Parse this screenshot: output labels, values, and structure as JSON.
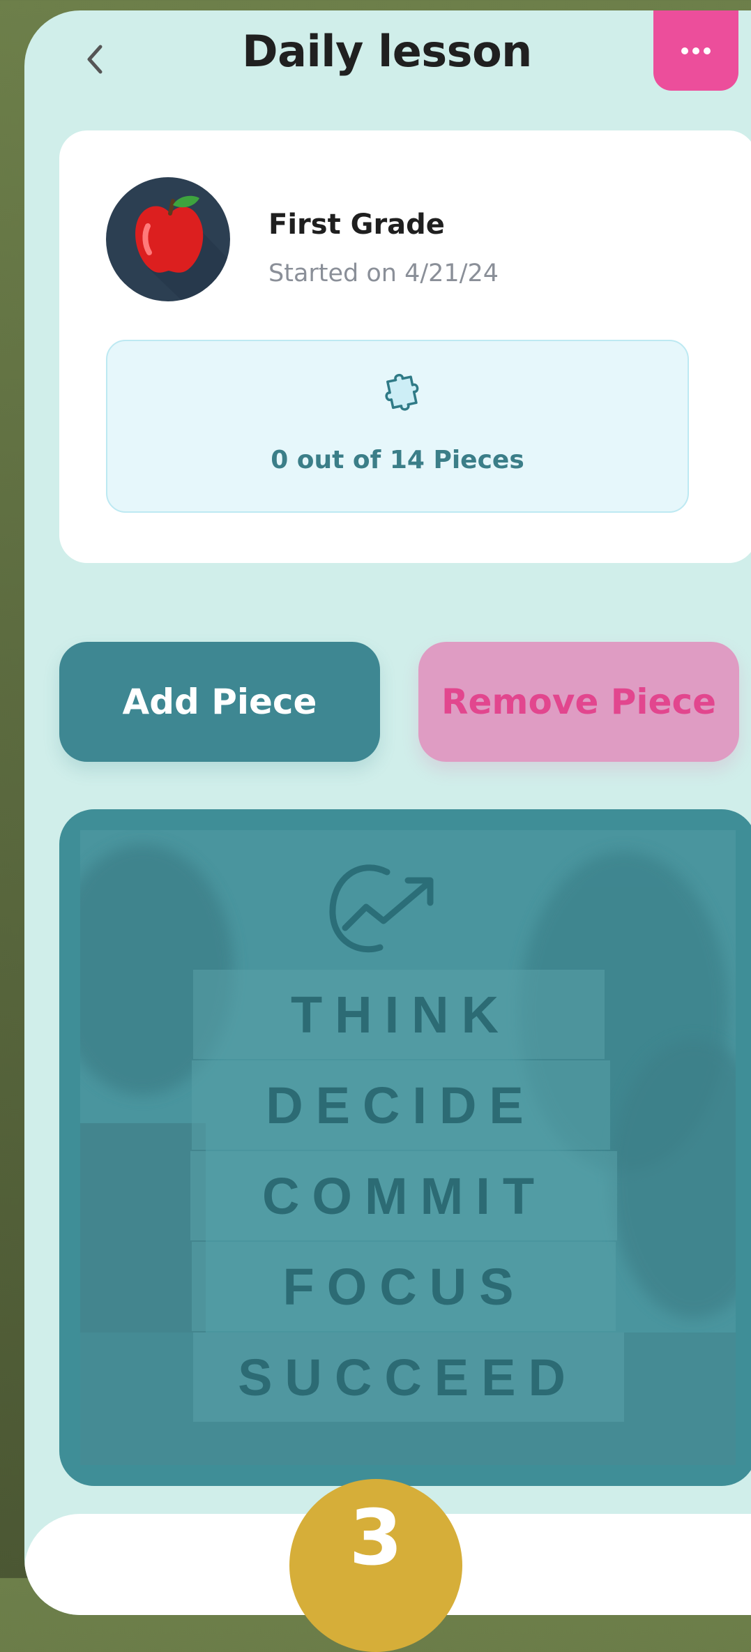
{
  "header": {
    "title": "Daily lesson",
    "back_icon": "chevron-left-icon",
    "more_icon": "more-dots-icon"
  },
  "lesson": {
    "grade": "First Grade",
    "started": "Started on 4/21/24",
    "avatar_icon": "apple-icon",
    "progress_icon": "puzzle-piece-icon",
    "progress_text": "0 out of 14 Pieces",
    "pieces_done": 0,
    "pieces_total": 14
  },
  "actions": {
    "add_label": "Add Piece",
    "remove_label": "Remove Piece"
  },
  "image": {
    "words": [
      "THINK",
      "DECIDE",
      "COMMIT",
      "FOCUS",
      "SUCCEED"
    ]
  },
  "step": {
    "number": "3"
  },
  "colors": {
    "background": "#d0eeea",
    "accent_pink": "#ec4e9b",
    "teal": "#3e8792",
    "remove_bg": "#df9cc3",
    "remove_text": "#e2468e",
    "progress_bg": "#e6f7fb",
    "progress_text": "#3b7e88",
    "step_gold": "#d6ae39"
  }
}
